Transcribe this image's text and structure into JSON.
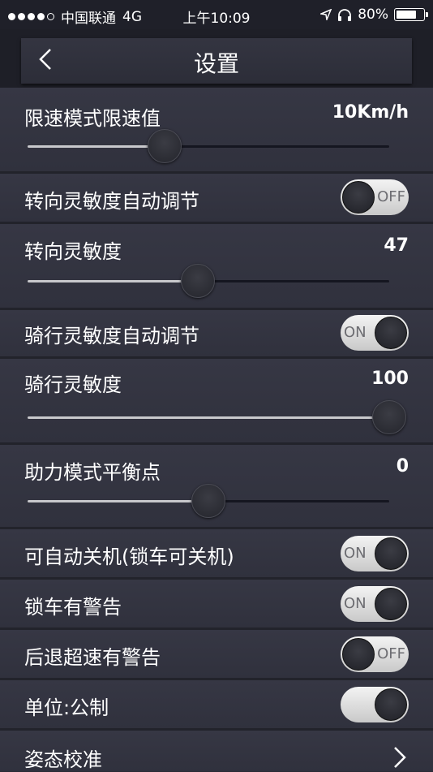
{
  "status_bar": {
    "carrier": "中国联通",
    "network": "4G",
    "time": "上午10:09",
    "battery": "80%",
    "battery_level": 0.8
  },
  "header": {
    "title": "设置",
    "back_icon": "chevron-left-icon"
  },
  "settings": {
    "speed_limit": {
      "label": "限速模式限速值",
      "value": "10Km/h",
      "slider_level": 0.38
    },
    "steering_auto": {
      "label": "转向灵敏度自动调节",
      "state": "OFF"
    },
    "steering": {
      "label": "转向灵敏度",
      "value": "47",
      "slider_level": 0.47
    },
    "riding_auto": {
      "label": "骑行灵敏度自动调节",
      "state": "ON"
    },
    "riding": {
      "label": "骑行灵敏度",
      "value": "100",
      "slider_level": 1.0
    },
    "assist_balance": {
      "label": "助力模式平衡点",
      "value": "0",
      "slider_level": 0.5
    },
    "auto_shutdown": {
      "label": "可自动关机(锁车可关机)",
      "state": "ON"
    },
    "lock_warning": {
      "label": "锁车有警告",
      "state": "ON"
    },
    "reverse_warning": {
      "label": "后退超速有警告",
      "state": "OFF"
    },
    "units": {
      "label": "单位:公制",
      "state": ""
    },
    "calibration": {
      "label": "姿态校准"
    }
  }
}
